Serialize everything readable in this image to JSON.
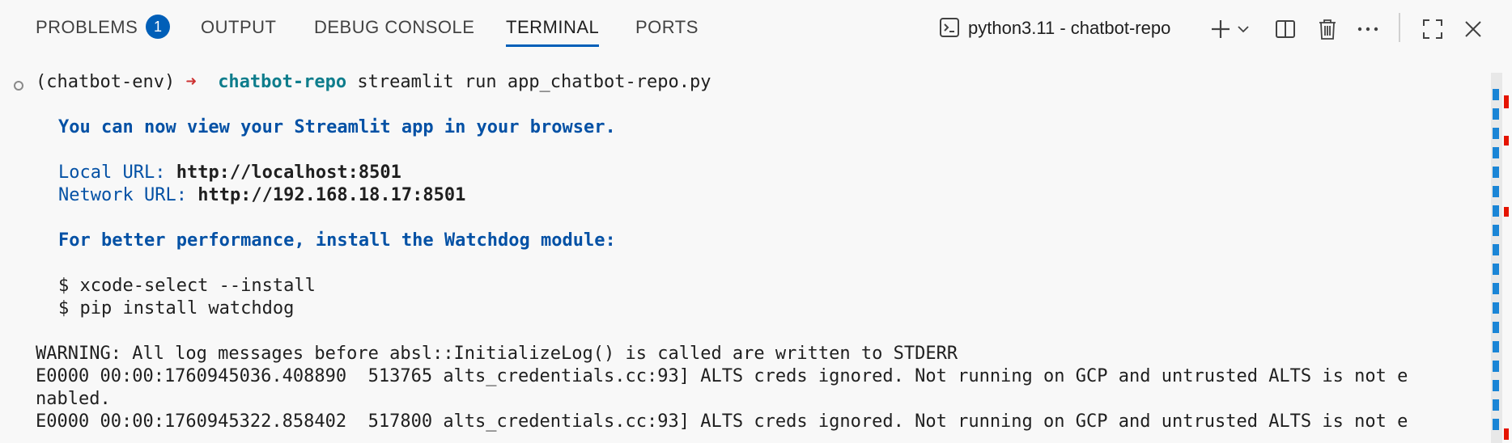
{
  "tabs": [
    {
      "label": "PROBLEMS",
      "badge": "1"
    },
    {
      "label": "OUTPUT"
    },
    {
      "label": "DEBUG CONSOLE"
    },
    {
      "label": "TERMINAL",
      "active": true
    },
    {
      "label": "PORTS"
    }
  ],
  "terminal_selector": {
    "label": "python3.11 - chatbot-repo",
    "icon": "terminal-icon"
  },
  "actions": [
    "add-terminal-icon",
    "chevron-down-icon",
    "split-icon",
    "trash-icon",
    "more-icon",
    "maximize-icon",
    "close-icon"
  ],
  "terminal": {
    "prompt_env": "(chatbot-env)",
    "prompt_arrow": "➜",
    "prompt_dir": "chatbot-repo",
    "command": "streamlit run app_chatbot-repo.py",
    "view_msg": "You can now view your Streamlit app in your browser.",
    "local_label": "Local URL:",
    "local_url": "http://localhost:8501",
    "network_label": "Network URL:",
    "network_url": "http://192.168.18.17:8501",
    "perf_msg": "For better performance, install the Watchdog module:",
    "cmd1": "$ xcode-select --install",
    "cmd2": "$ pip install watchdog",
    "warning": "WARNING: All log messages before absl::InitializeLog() is called are written to STDERR",
    "err1a": "E0000 00:00:1760945036.408890  513765 alts_credentials.cc:93] ALTS creds ignored. Not running on GCP and untrusted ALTS is not e",
    "err1b": "nabled.",
    "err2": "E0000 00:00:1760945322.858402  517800 alts_credentials.cc:93] ALTS creds ignored. Not running on GCP and untrusted ALTS is not e"
  },
  "colors": {
    "accent": "#005fb8",
    "prompt_dir": "#0e7d8c",
    "streamlit_blue": "#0451a5",
    "arrow": "#cd3131"
  }
}
